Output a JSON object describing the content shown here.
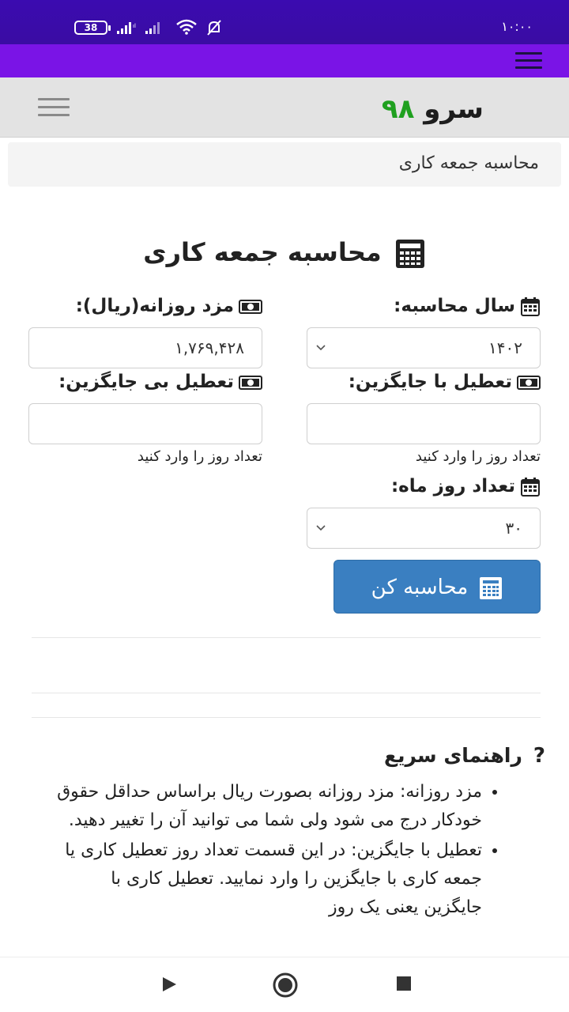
{
  "status_bar": {
    "battery": "38",
    "clock": "۱۰:۰۰"
  },
  "header": {
    "logo_word": "سرو",
    "logo_number": "۹۸"
  },
  "breadcrumb": "محاسبه جمعه کاری",
  "page_title": "محاسبه جمعه کاری",
  "form": {
    "year_label": "سال محاسبه:",
    "year_value": "۱۴۰۲",
    "wage_label": "مزد روزانه(ریال):",
    "wage_value": "۱,۷۶۹,۴۲۸",
    "holiday_with_label": "تعطیل با جایگزین:",
    "holiday_without_label": "تعطیل بی جایگزین:",
    "days_hint": "تعداد روز را وارد کنید",
    "month_days_label": "تعداد روز ماه:",
    "month_days_value": "۳۰",
    "submit_label": "محاسبه کن"
  },
  "guide": {
    "title": "راهنمای سریع",
    "items": [
      "مزد روزانه: مزد روزانه بصورت ریال براساس حداقل حقوق خودکار درج می شود ولی شما می توانید آن را تغییر دهید.",
      "تعطیل با جایگزین: در این قسمت تعداد روز تعطیل کاری یا جمعه کاری با جایگزین را وارد نمایید. تعطیل کاری با جایگزین یعنی یک روز"
    ]
  },
  "icons": {
    "accent": "#7a14e6",
    "status_bg": "#3a0ca3",
    "button_bg": "#3a7fc1",
    "logo_green": "#1fa01f"
  }
}
